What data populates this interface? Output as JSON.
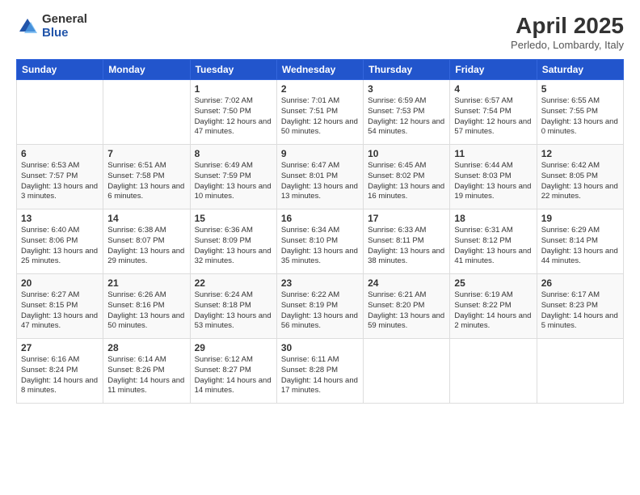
{
  "header": {
    "logo_general": "General",
    "logo_blue": "Blue",
    "month_year": "April 2025",
    "location": "Perledo, Lombardy, Italy"
  },
  "days_of_week": [
    "Sunday",
    "Monday",
    "Tuesday",
    "Wednesday",
    "Thursday",
    "Friday",
    "Saturday"
  ],
  "weeks": [
    [
      {
        "day": "",
        "info": ""
      },
      {
        "day": "",
        "info": ""
      },
      {
        "day": "1",
        "info": "Sunrise: 7:02 AM\nSunset: 7:50 PM\nDaylight: 12 hours and 47 minutes."
      },
      {
        "day": "2",
        "info": "Sunrise: 7:01 AM\nSunset: 7:51 PM\nDaylight: 12 hours and 50 minutes."
      },
      {
        "day": "3",
        "info": "Sunrise: 6:59 AM\nSunset: 7:53 PM\nDaylight: 12 hours and 54 minutes."
      },
      {
        "day": "4",
        "info": "Sunrise: 6:57 AM\nSunset: 7:54 PM\nDaylight: 12 hours and 57 minutes."
      },
      {
        "day": "5",
        "info": "Sunrise: 6:55 AM\nSunset: 7:55 PM\nDaylight: 13 hours and 0 minutes."
      }
    ],
    [
      {
        "day": "6",
        "info": "Sunrise: 6:53 AM\nSunset: 7:57 PM\nDaylight: 13 hours and 3 minutes."
      },
      {
        "day": "7",
        "info": "Sunrise: 6:51 AM\nSunset: 7:58 PM\nDaylight: 13 hours and 6 minutes."
      },
      {
        "day": "8",
        "info": "Sunrise: 6:49 AM\nSunset: 7:59 PM\nDaylight: 13 hours and 10 minutes."
      },
      {
        "day": "9",
        "info": "Sunrise: 6:47 AM\nSunset: 8:01 PM\nDaylight: 13 hours and 13 minutes."
      },
      {
        "day": "10",
        "info": "Sunrise: 6:45 AM\nSunset: 8:02 PM\nDaylight: 13 hours and 16 minutes."
      },
      {
        "day": "11",
        "info": "Sunrise: 6:44 AM\nSunset: 8:03 PM\nDaylight: 13 hours and 19 minutes."
      },
      {
        "day": "12",
        "info": "Sunrise: 6:42 AM\nSunset: 8:05 PM\nDaylight: 13 hours and 22 minutes."
      }
    ],
    [
      {
        "day": "13",
        "info": "Sunrise: 6:40 AM\nSunset: 8:06 PM\nDaylight: 13 hours and 25 minutes."
      },
      {
        "day": "14",
        "info": "Sunrise: 6:38 AM\nSunset: 8:07 PM\nDaylight: 13 hours and 29 minutes."
      },
      {
        "day": "15",
        "info": "Sunrise: 6:36 AM\nSunset: 8:09 PM\nDaylight: 13 hours and 32 minutes."
      },
      {
        "day": "16",
        "info": "Sunrise: 6:34 AM\nSunset: 8:10 PM\nDaylight: 13 hours and 35 minutes."
      },
      {
        "day": "17",
        "info": "Sunrise: 6:33 AM\nSunset: 8:11 PM\nDaylight: 13 hours and 38 minutes."
      },
      {
        "day": "18",
        "info": "Sunrise: 6:31 AM\nSunset: 8:12 PM\nDaylight: 13 hours and 41 minutes."
      },
      {
        "day": "19",
        "info": "Sunrise: 6:29 AM\nSunset: 8:14 PM\nDaylight: 13 hours and 44 minutes."
      }
    ],
    [
      {
        "day": "20",
        "info": "Sunrise: 6:27 AM\nSunset: 8:15 PM\nDaylight: 13 hours and 47 minutes."
      },
      {
        "day": "21",
        "info": "Sunrise: 6:26 AM\nSunset: 8:16 PM\nDaylight: 13 hours and 50 minutes."
      },
      {
        "day": "22",
        "info": "Sunrise: 6:24 AM\nSunset: 8:18 PM\nDaylight: 13 hours and 53 minutes."
      },
      {
        "day": "23",
        "info": "Sunrise: 6:22 AM\nSunset: 8:19 PM\nDaylight: 13 hours and 56 minutes."
      },
      {
        "day": "24",
        "info": "Sunrise: 6:21 AM\nSunset: 8:20 PM\nDaylight: 13 hours and 59 minutes."
      },
      {
        "day": "25",
        "info": "Sunrise: 6:19 AM\nSunset: 8:22 PM\nDaylight: 14 hours and 2 minutes."
      },
      {
        "day": "26",
        "info": "Sunrise: 6:17 AM\nSunset: 8:23 PM\nDaylight: 14 hours and 5 minutes."
      }
    ],
    [
      {
        "day": "27",
        "info": "Sunrise: 6:16 AM\nSunset: 8:24 PM\nDaylight: 14 hours and 8 minutes."
      },
      {
        "day": "28",
        "info": "Sunrise: 6:14 AM\nSunset: 8:26 PM\nDaylight: 14 hours and 11 minutes."
      },
      {
        "day": "29",
        "info": "Sunrise: 6:12 AM\nSunset: 8:27 PM\nDaylight: 14 hours and 14 minutes."
      },
      {
        "day": "30",
        "info": "Sunrise: 6:11 AM\nSunset: 8:28 PM\nDaylight: 14 hours and 17 minutes."
      },
      {
        "day": "",
        "info": ""
      },
      {
        "day": "",
        "info": ""
      },
      {
        "day": "",
        "info": ""
      }
    ]
  ]
}
